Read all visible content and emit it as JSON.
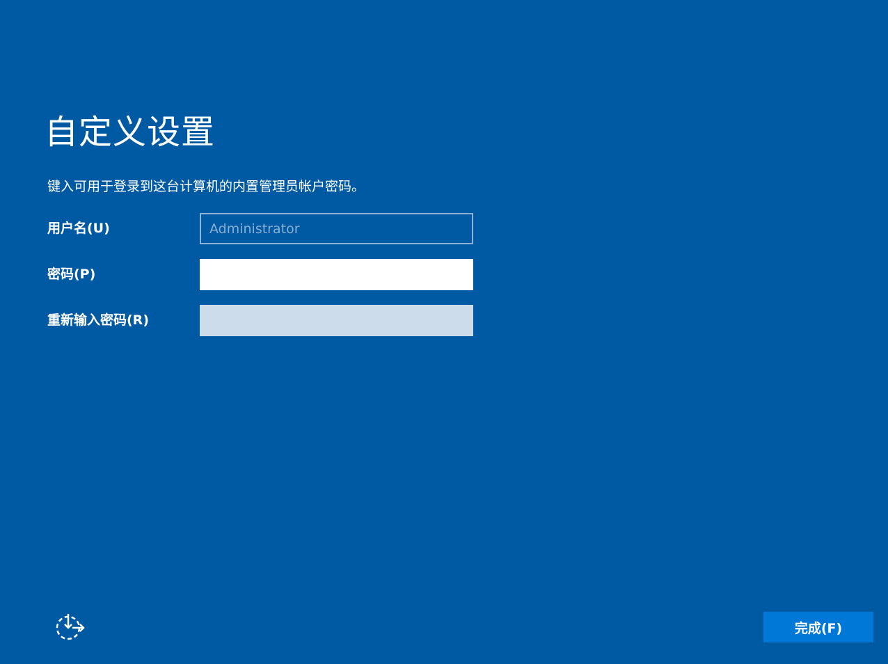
{
  "page": {
    "title": "自定义设置",
    "subtitle": "键入可用于登录到这台计算机的内置管理员帐户密码。"
  },
  "form": {
    "username": {
      "label": "用户名(U)",
      "placeholder": "Administrator",
      "value": ""
    },
    "password": {
      "label": "密码(P)",
      "value": ""
    },
    "reenter_password": {
      "label": "重新输入密码(R)",
      "value": ""
    }
  },
  "footer": {
    "accessibility_icon": "ease-of-access-icon",
    "finish_label": "完成(F)"
  },
  "colors": {
    "background": "#005aa3",
    "button": "#0078d7",
    "text": "#ffffff",
    "disabled_field": "#ccdceb"
  }
}
